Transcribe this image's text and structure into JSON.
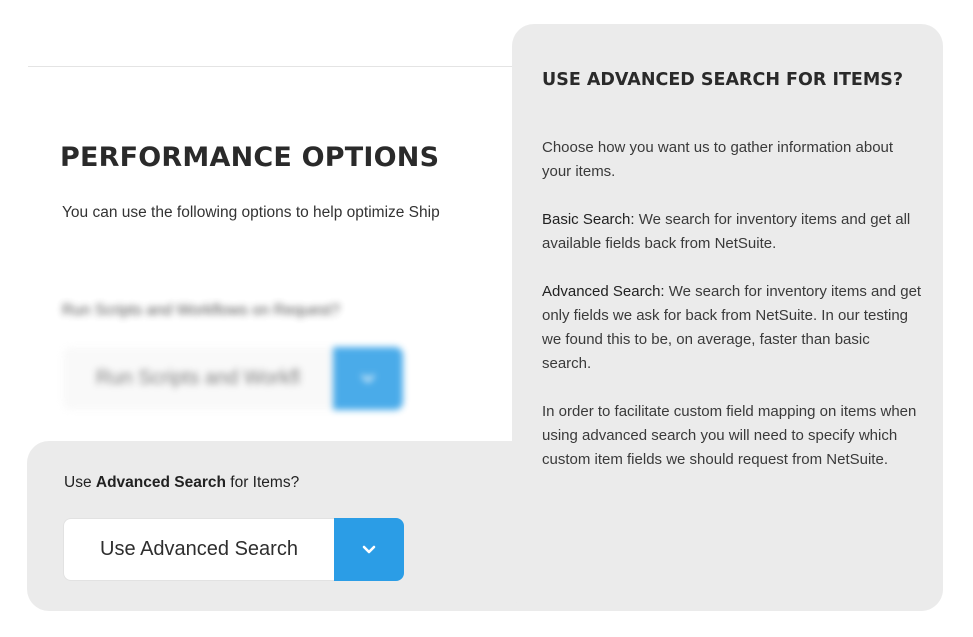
{
  "performance": {
    "title": "PERFORMANCE OPTIONS",
    "intro": "You can use the following options to help optimize Ship"
  },
  "run_scripts": {
    "label": "Run Scripts and Workflows on Request?",
    "selected": "Run Scripts and Workfl"
  },
  "advanced_search": {
    "label_prefix": "Use ",
    "label_bold": "Advanced Search",
    "label_suffix": " for Items?",
    "selected": "Use Advanced Search"
  },
  "tooltip": {
    "title": "USE ADVANCED SEARCH FOR ITEMS?",
    "intro": "Choose how you want us to gather information about your items.",
    "basic_term": "Basic Search:",
    "basic_text": " We search for inventory items and get all available fields back from NetSuite.",
    "advanced_term": "Advanced Search:",
    "advanced_text": " We search for inventory items and get only fields we ask for back from NetSuite. In our testing we found this to be, on average, faster than basic search.",
    "custom_note": "In order to facilitate custom field mapping on items when using advanced search you will need to specify which custom item fields we should request from NetSuite."
  },
  "icons": {
    "dropdown": "chevron-down-icon"
  },
  "colors": {
    "accent": "#2b9de6",
    "panel": "#ebebeb"
  }
}
